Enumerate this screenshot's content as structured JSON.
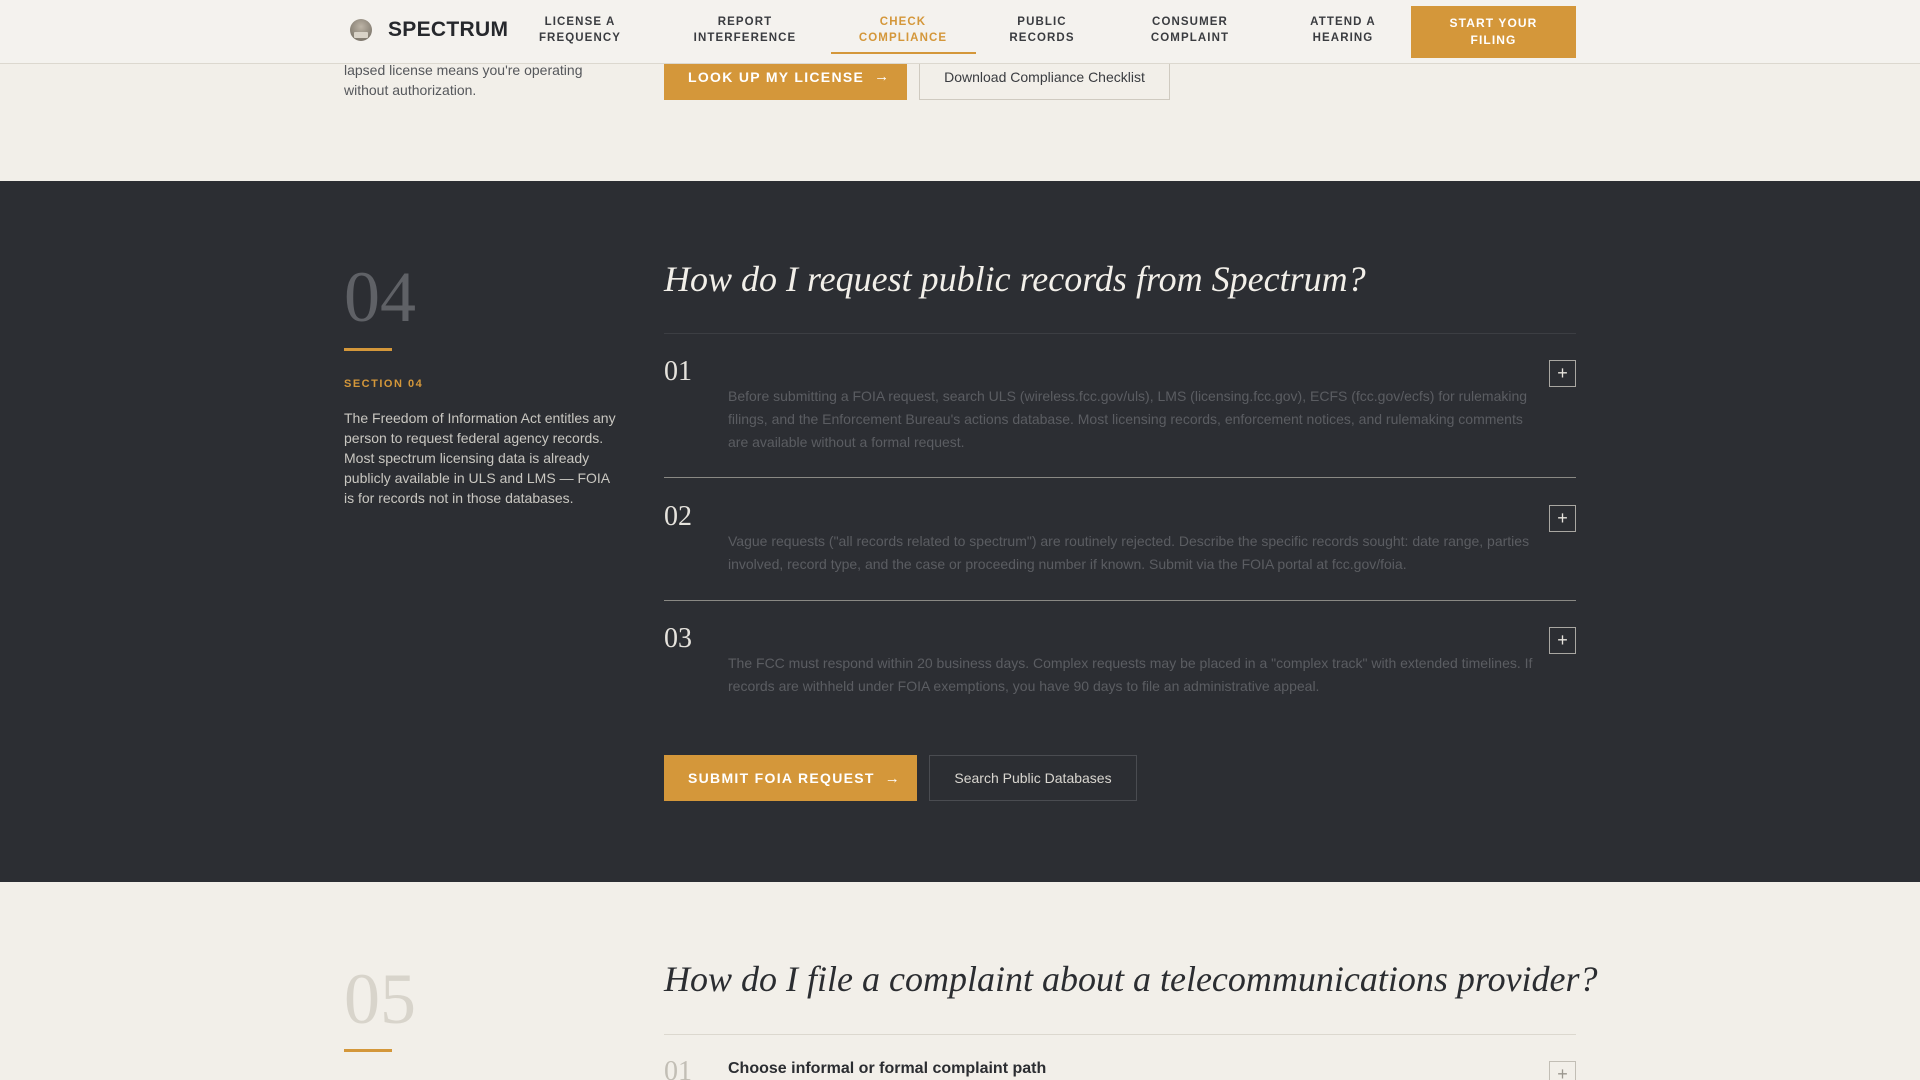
{
  "nav": {
    "brand": "SPECTRUM",
    "items": [
      {
        "line1": "LICENSE A",
        "line2": "FREQUENCY"
      },
      {
        "line1": "REPORT",
        "line2": "INTERFERENCE"
      },
      {
        "line1": "CHECK",
        "line2": "COMPLIANCE"
      },
      {
        "line1": "PUBLIC",
        "line2": "RECORDS"
      },
      {
        "line1": "CONSUMER",
        "line2": "COMPLAINT"
      },
      {
        "line1": "ATTEND A",
        "line2": "HEARING"
      }
    ],
    "active_index": 2,
    "cta": {
      "line1": "START YOUR",
      "line2": "FILING"
    }
  },
  "top_section": {
    "text": "lapsed license means you're operating without authorization.",
    "primary_button": "LOOK UP MY LICENSE",
    "secondary_button": "Download Compliance Checklist"
  },
  "section_04": {
    "number": "04",
    "label": "SECTION 04",
    "description": "The Freedom of Information Act entitles any person to request federal agency records. Most spectrum licensing data is already publicly available in ULS and LMS — FOIA is for records not in those databases.",
    "question": "How do I request public records from Spectrum?",
    "faqs": [
      {
        "num": "01",
        "body": "Before submitting a FOIA request, search ULS (wireless.fcc.gov/uls), LMS (licensing.fcc.gov), ECFS (fcc.gov/ecfs) for rulemaking filings, and the Enforcement Bureau's actions database. Most licensing records, enforcement notices, and rulemaking comments are available without a formal request."
      },
      {
        "num": "02",
        "body": "Vague requests (\"all records related to spectrum\") are routinely rejected. Describe the specific records sought: date range, parties involved, record type, and the case or proceeding number if known. Submit via the FOIA portal at fcc.gov/foia."
      },
      {
        "num": "03",
        "body": "The FCC must respond within 20 business days. Complex requests may be placed in a \"complex track\" with extended timelines. If records are withheld under FOIA exemptions, you have 90 days to file an administrative appeal."
      }
    ],
    "primary_button": "SUBMIT FOIA REQUEST",
    "secondary_button": "Search Public Databases"
  },
  "section_05": {
    "number": "05",
    "question": "How do I file a complaint about a telecommunications provider?",
    "faqs": [
      {
        "num": "01",
        "title": "Choose informal or formal complaint path"
      }
    ]
  },
  "icons": {
    "arrow": "→",
    "plus": "+"
  },
  "colors": {
    "accent": "#d4973a",
    "dark_bg": "#2c2e33",
    "light_bg": "#f2efe9"
  }
}
